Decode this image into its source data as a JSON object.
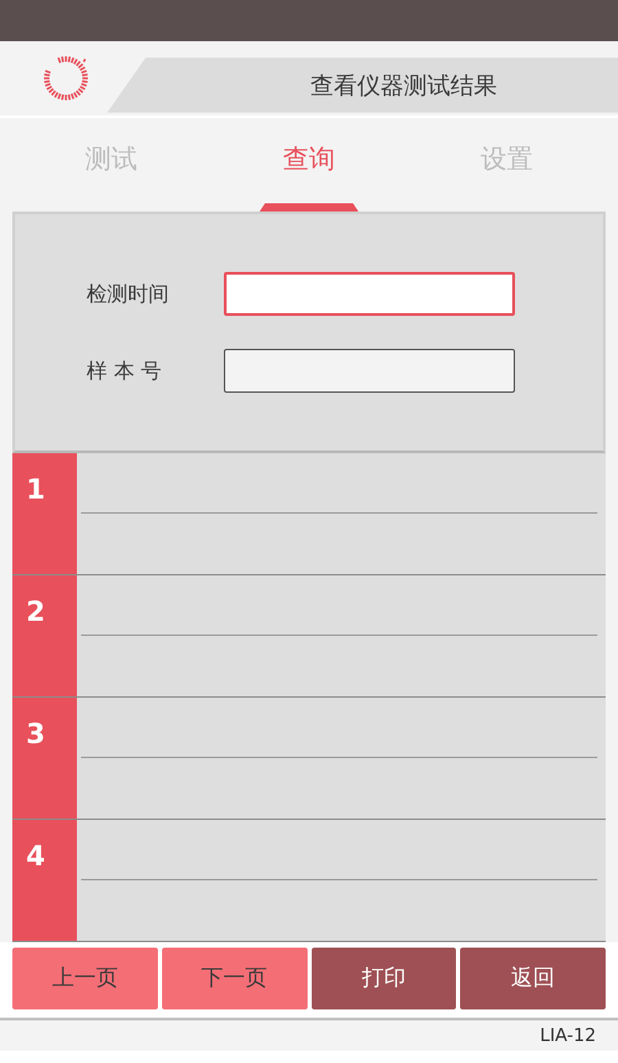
{
  "header": {
    "title": "查看仪器测试结果"
  },
  "tabs": [
    {
      "label": "测试",
      "selected": false
    },
    {
      "label": "查询",
      "selected": true
    },
    {
      "label": "设置",
      "selected": false
    }
  ],
  "form": {
    "fields": [
      {
        "label": "检测时间",
        "focused": true
      },
      {
        "label": "样 本 号",
        "focused": false
      }
    ]
  },
  "results": [
    {
      "number": "1"
    },
    {
      "number": "2"
    },
    {
      "number": "3"
    },
    {
      "number": "4"
    }
  ],
  "buttons": [
    {
      "label": "上一页",
      "kind": "page"
    },
    {
      "label": "下一页",
      "kind": "page"
    },
    {
      "label": "打印",
      "kind": "action"
    },
    {
      "label": "返回",
      "kind": "action"
    }
  ],
  "footer": {
    "model": "LIA-12"
  }
}
